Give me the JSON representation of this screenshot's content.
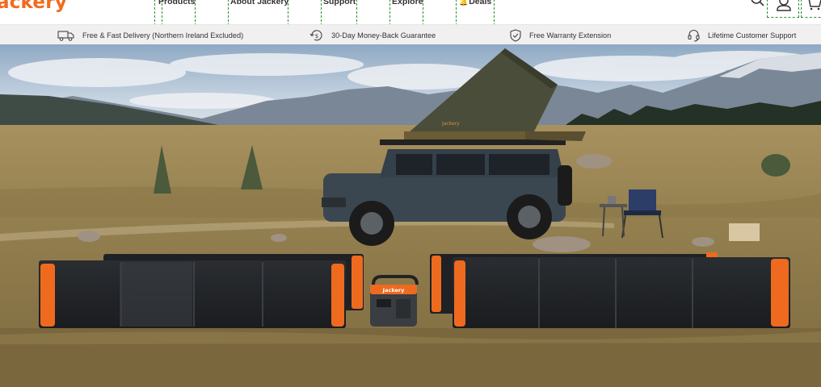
{
  "header": {
    "logo_text": "ackery",
    "nav": [
      {
        "label": "Products"
      },
      {
        "label": "About Jackery"
      },
      {
        "label": "Support"
      },
      {
        "label": "Explore"
      },
      {
        "label": "Deals"
      }
    ]
  },
  "promo": {
    "items": [
      {
        "label": "Free & Fast Delivery (Northern Ireland Excluded)",
        "icon": "truck-icon"
      },
      {
        "label": "30-Day Money-Back Guarantee",
        "icon": "money-back-icon"
      },
      {
        "label": "Free Warranty Extension",
        "icon": "shield-check-icon"
      },
      {
        "label": "Lifetime Customer Support",
        "icon": "headset-icon"
      }
    ]
  },
  "hero": {
    "product_brand": "Jackery",
    "tent_brand": "Jackery"
  },
  "colors": {
    "brand_orange": "#f26a1b",
    "promo_bg": "#f0f0f0"
  }
}
